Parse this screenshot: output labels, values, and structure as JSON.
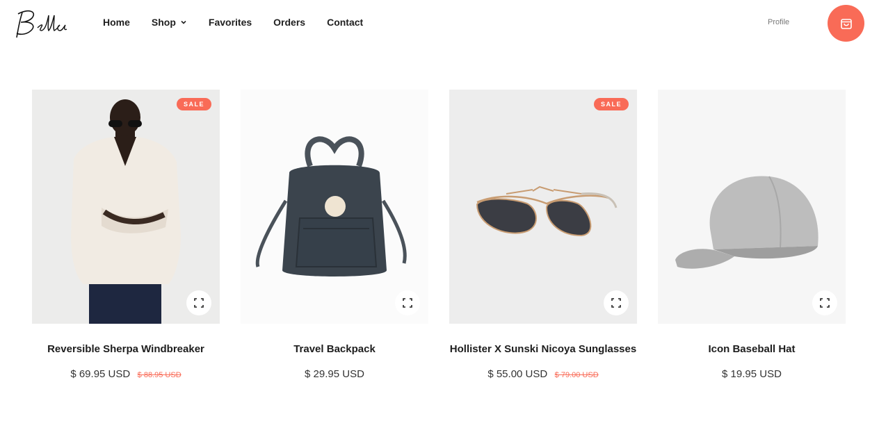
{
  "brand": {
    "logo_text": "Bella"
  },
  "nav": {
    "items": [
      {
        "label": "Home"
      },
      {
        "label": "Shop"
      },
      {
        "label": "Favorites"
      },
      {
        "label": "Orders"
      },
      {
        "label": "Contact"
      }
    ]
  },
  "header": {
    "profile_label": "Profile",
    "cart_icon": "shopping-bag-icon"
  },
  "colors": {
    "accent": "#f96b57"
  },
  "products": [
    {
      "title": "Reversible Sherpa Windbreaker",
      "price": "$ 69.95 USD",
      "old_price": "$ 88.95 USD",
      "badge": "SALE"
    },
    {
      "title": "Travel Backpack",
      "price": "$ 29.95 USD"
    },
    {
      "title": "Hollister X Sunski Nicoya Sunglasses",
      "price": "$ 55.00 USD",
      "old_price": "$ 79.00 USD",
      "badge": "SALE"
    },
    {
      "title": "Icon Baseball Hat",
      "price": "$ 19.95 USD"
    }
  ]
}
